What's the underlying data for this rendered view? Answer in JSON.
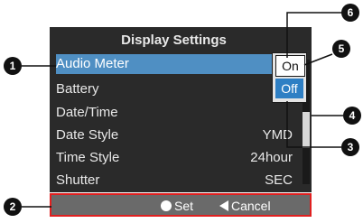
{
  "menu": {
    "title": "Display Settings",
    "items": [
      {
        "label": "Audio Meter",
        "value": ""
      },
      {
        "label": "Battery",
        "value": ""
      },
      {
        "label": "Date/Time",
        "value": ""
      },
      {
        "label": "Date Style",
        "value": "YMD"
      },
      {
        "label": "Time Style",
        "value": "24hour"
      },
      {
        "label": "Shutter",
        "value": "SEC"
      }
    ],
    "popup": {
      "options": [
        "On",
        "Off"
      ],
      "selected": "Off"
    }
  },
  "footer": {
    "set_label": "Set",
    "cancel_label": "Cancel"
  },
  "callouts": [
    "1",
    "2",
    "3",
    "4",
    "5",
    "6"
  ],
  "colors": {
    "highlight": "#4f8fc3",
    "frame": "#e02020",
    "background": "#2a2a2a"
  }
}
